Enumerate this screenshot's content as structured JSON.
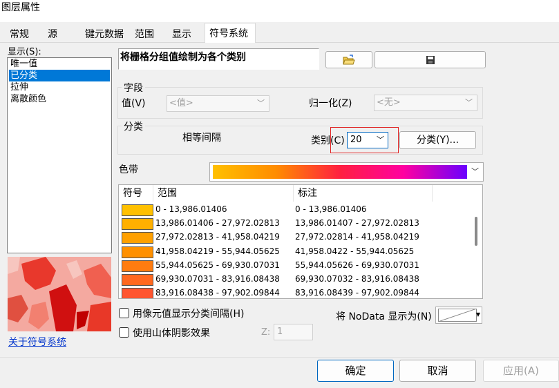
{
  "window": {
    "title": "图层属性"
  },
  "tabs": [
    {
      "label": "常规"
    },
    {
      "label": "源"
    },
    {
      "label": "键元数据"
    },
    {
      "label": "范围"
    },
    {
      "label": "显示"
    },
    {
      "label": "符号系统"
    }
  ],
  "show": {
    "label": "显示(S):",
    "items": [
      "唯一值",
      "已分类",
      "拉伸",
      "离散颜色"
    ],
    "selected": "已分类",
    "about_link": "关于符号系统"
  },
  "header": {
    "title": "将栅格分组值绘制为各个类别",
    "open_icon": "folder-open-icon",
    "save_icon": "save-icon"
  },
  "field_group": {
    "label": "字段",
    "value_label": "值(V)",
    "value_placeholder": "<值>",
    "normalize_label": "归一化(Z)",
    "normalize_value": "<无>"
  },
  "classify_group": {
    "label": "分类",
    "method": "相等间隔",
    "classes_label": "类别(C)",
    "classes_value": "20",
    "classify_button": "分类(Y)..."
  },
  "color_ramp": {
    "label": "色带",
    "colors": [
      "#ffc000",
      "#ff8c00",
      "#ff2040",
      "#ff00a0",
      "#6a00ff"
    ]
  },
  "table": {
    "headers": [
      "符号",
      "范围",
      "标注"
    ],
    "rows": [
      {
        "color": "#ffc000",
        "range": "0 - 13,986.01406",
        "label": "0 - 13,986.01406"
      },
      {
        "color": "#ffb000",
        "range": "13,986.01406 - 27,972.02813",
        "label": "13,986.01407 - 27,972.02813"
      },
      {
        "color": "#ffa000",
        "range": "27,972.02813 - 41,958.04219",
        "label": "27,972.02814 - 41,958.04219"
      },
      {
        "color": "#ff9000",
        "range": "41,958.04219 - 55,944.05625",
        "label": "41,958.0422 - 55,944.05625"
      },
      {
        "color": "#ff7c10",
        "range": "55,944.05625 - 69,930.07031",
        "label": "55,944.05626 - 69,930.07031"
      },
      {
        "color": "#ff6820",
        "range": "69,930.07031 - 83,916.08438",
        "label": "69,930.07032 - 83,916.08438"
      },
      {
        "color": "#ff5530",
        "range": "83,916.08438 - 97,902.09844",
        "label": "83,916.08439 - 97,902.09844"
      }
    ]
  },
  "options": {
    "pixel_classes": "用像元值显示分类间隔(H)",
    "hillshade": "使用山体阴影效果",
    "z_label": "Z:",
    "z_value": "1",
    "nodata_label": "将 NoData 显示为(N)"
  },
  "buttons": {
    "ok": "确定",
    "cancel": "取消",
    "apply": "应用(A)"
  }
}
